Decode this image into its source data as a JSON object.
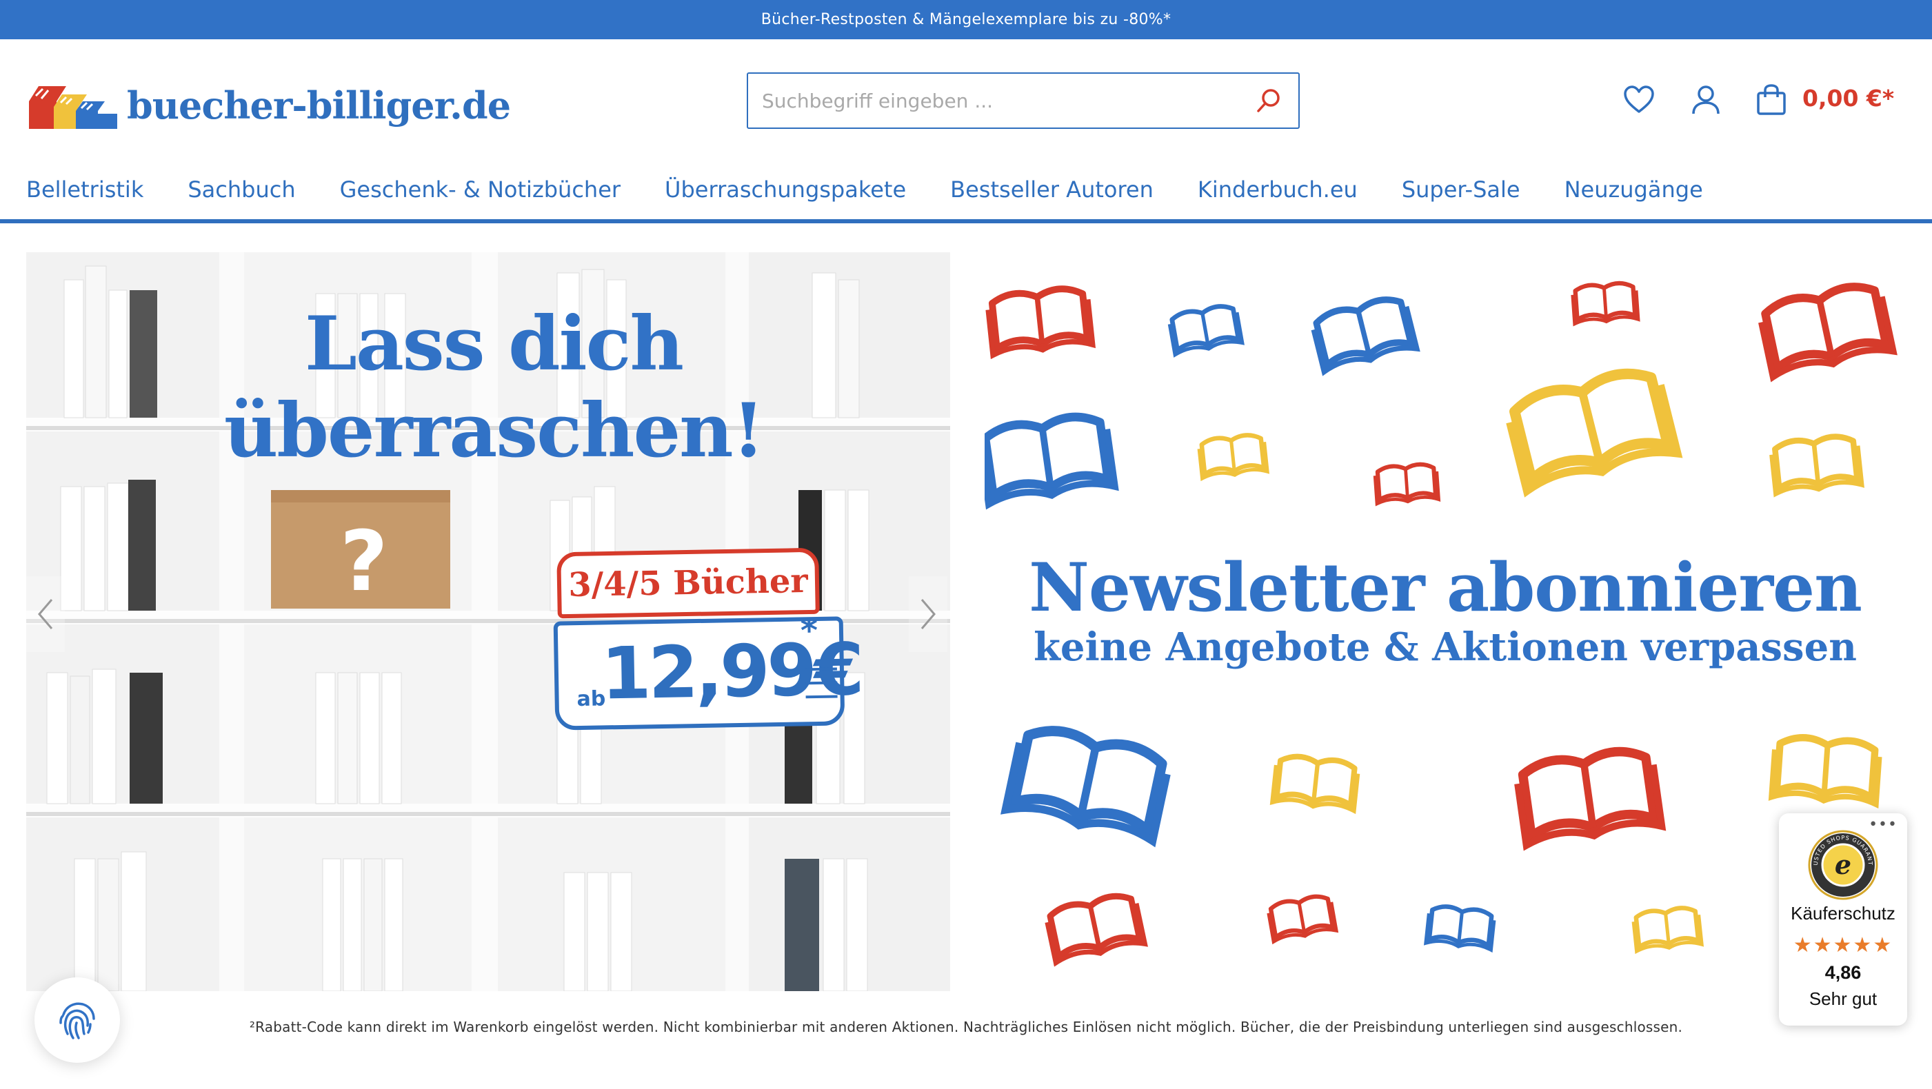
{
  "topbar": {
    "text": "Bücher-Restposten & Mängelexemplare bis zu -80%*"
  },
  "header": {
    "logo_text": "buecher-billiger.de",
    "search_placeholder": "Suchbegriff eingeben ...",
    "icons": [
      "heart-icon",
      "user-icon",
      "shopping-bag-icon",
      "search-icon"
    ],
    "cart_total": "0,00 €*"
  },
  "nav": {
    "items": [
      {
        "label": "Belletristik"
      },
      {
        "label": "Sachbuch"
      },
      {
        "label": "Geschenk- & Notizbücher"
      },
      {
        "label": "Überraschungspakete"
      },
      {
        "label": "Bestseller Autoren"
      },
      {
        "label": "Kinderbuch.eu"
      },
      {
        "label": "Super-Sale"
      },
      {
        "label": "Neuzugänge"
      }
    ]
  },
  "slider": {
    "left_slide": {
      "headline": "Lass dich überraschen!",
      "question_mark": "?",
      "badge_top": "3/4/5 Bücher",
      "badge_ab": "ab",
      "badge_price": "12,99€",
      "badge_star": "*"
    },
    "right_slide": {
      "title": "Newsletter abonnieren",
      "subtitle": "keine Angebote  & Aktionen verpassen"
    }
  },
  "footnote": "²Rabatt-Code kann direkt im Warenkorb eingelöst werden. Nicht kombinierbar mit anderen Aktionen. Nachträgliches Einlösen nicht möglich. Bücher, die der Preisbindung unterliegen sind ausgeschlossen.",
  "trusted_shops": {
    "dots": "•••",
    "seal_text": "TRUSTED SHOPS GUARANTEE",
    "label": "Käuferschutz",
    "stars": "★★★★★",
    "score": "4,86",
    "rating_text": "Sehr gut"
  },
  "colors": {
    "brand_blue": "#3172c6",
    "red": "#d63b2b",
    "yellow": "#f0c23c",
    "star_orange": "#e97c2a"
  }
}
